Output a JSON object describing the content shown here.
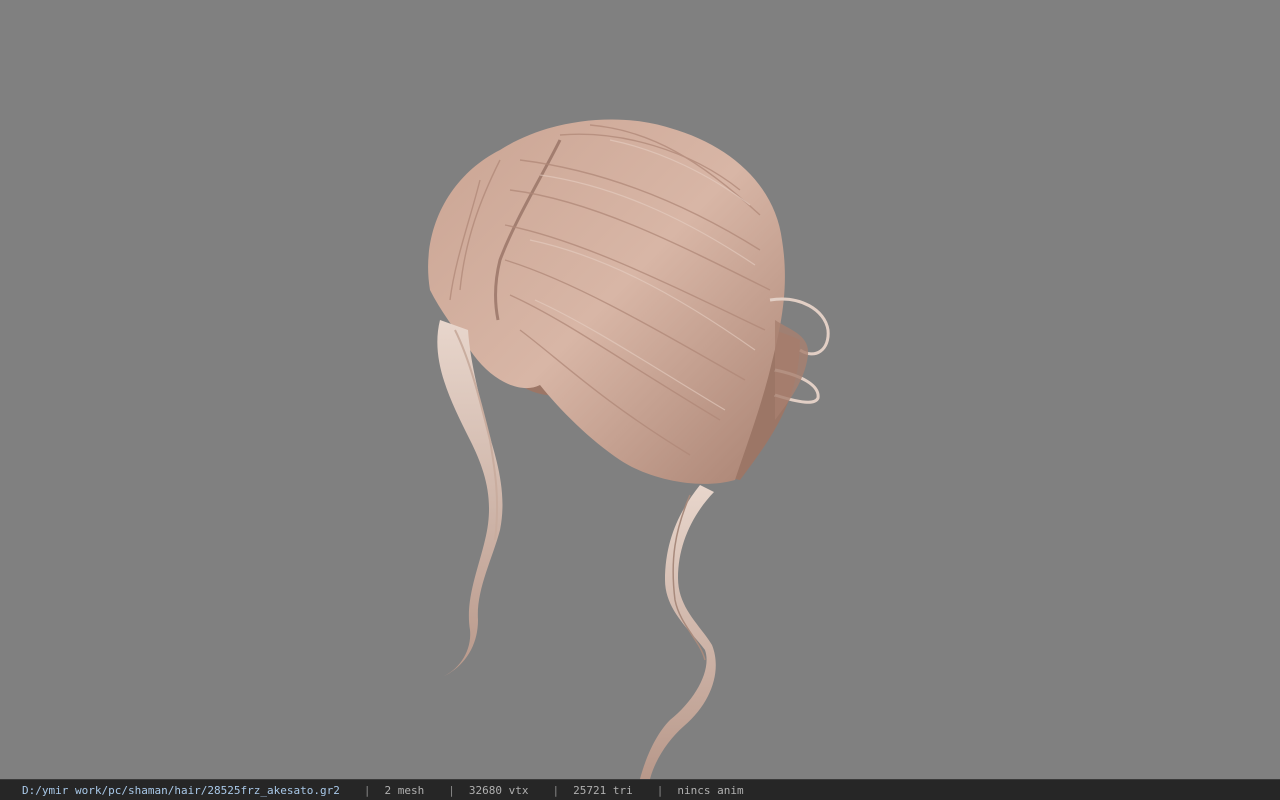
{
  "viewer": {
    "background_color": "#808080",
    "model_icon": "hair-model-render",
    "hair_color": "#c9a493"
  },
  "status": {
    "file_path": "D:/ymir work/pc/shaman/hair/28525frz_akesato.gr2",
    "separator": "|",
    "mesh": "2 mesh",
    "vertices": "32680 vtx",
    "triangles": "25721 tri",
    "anim": "nincs anim"
  }
}
